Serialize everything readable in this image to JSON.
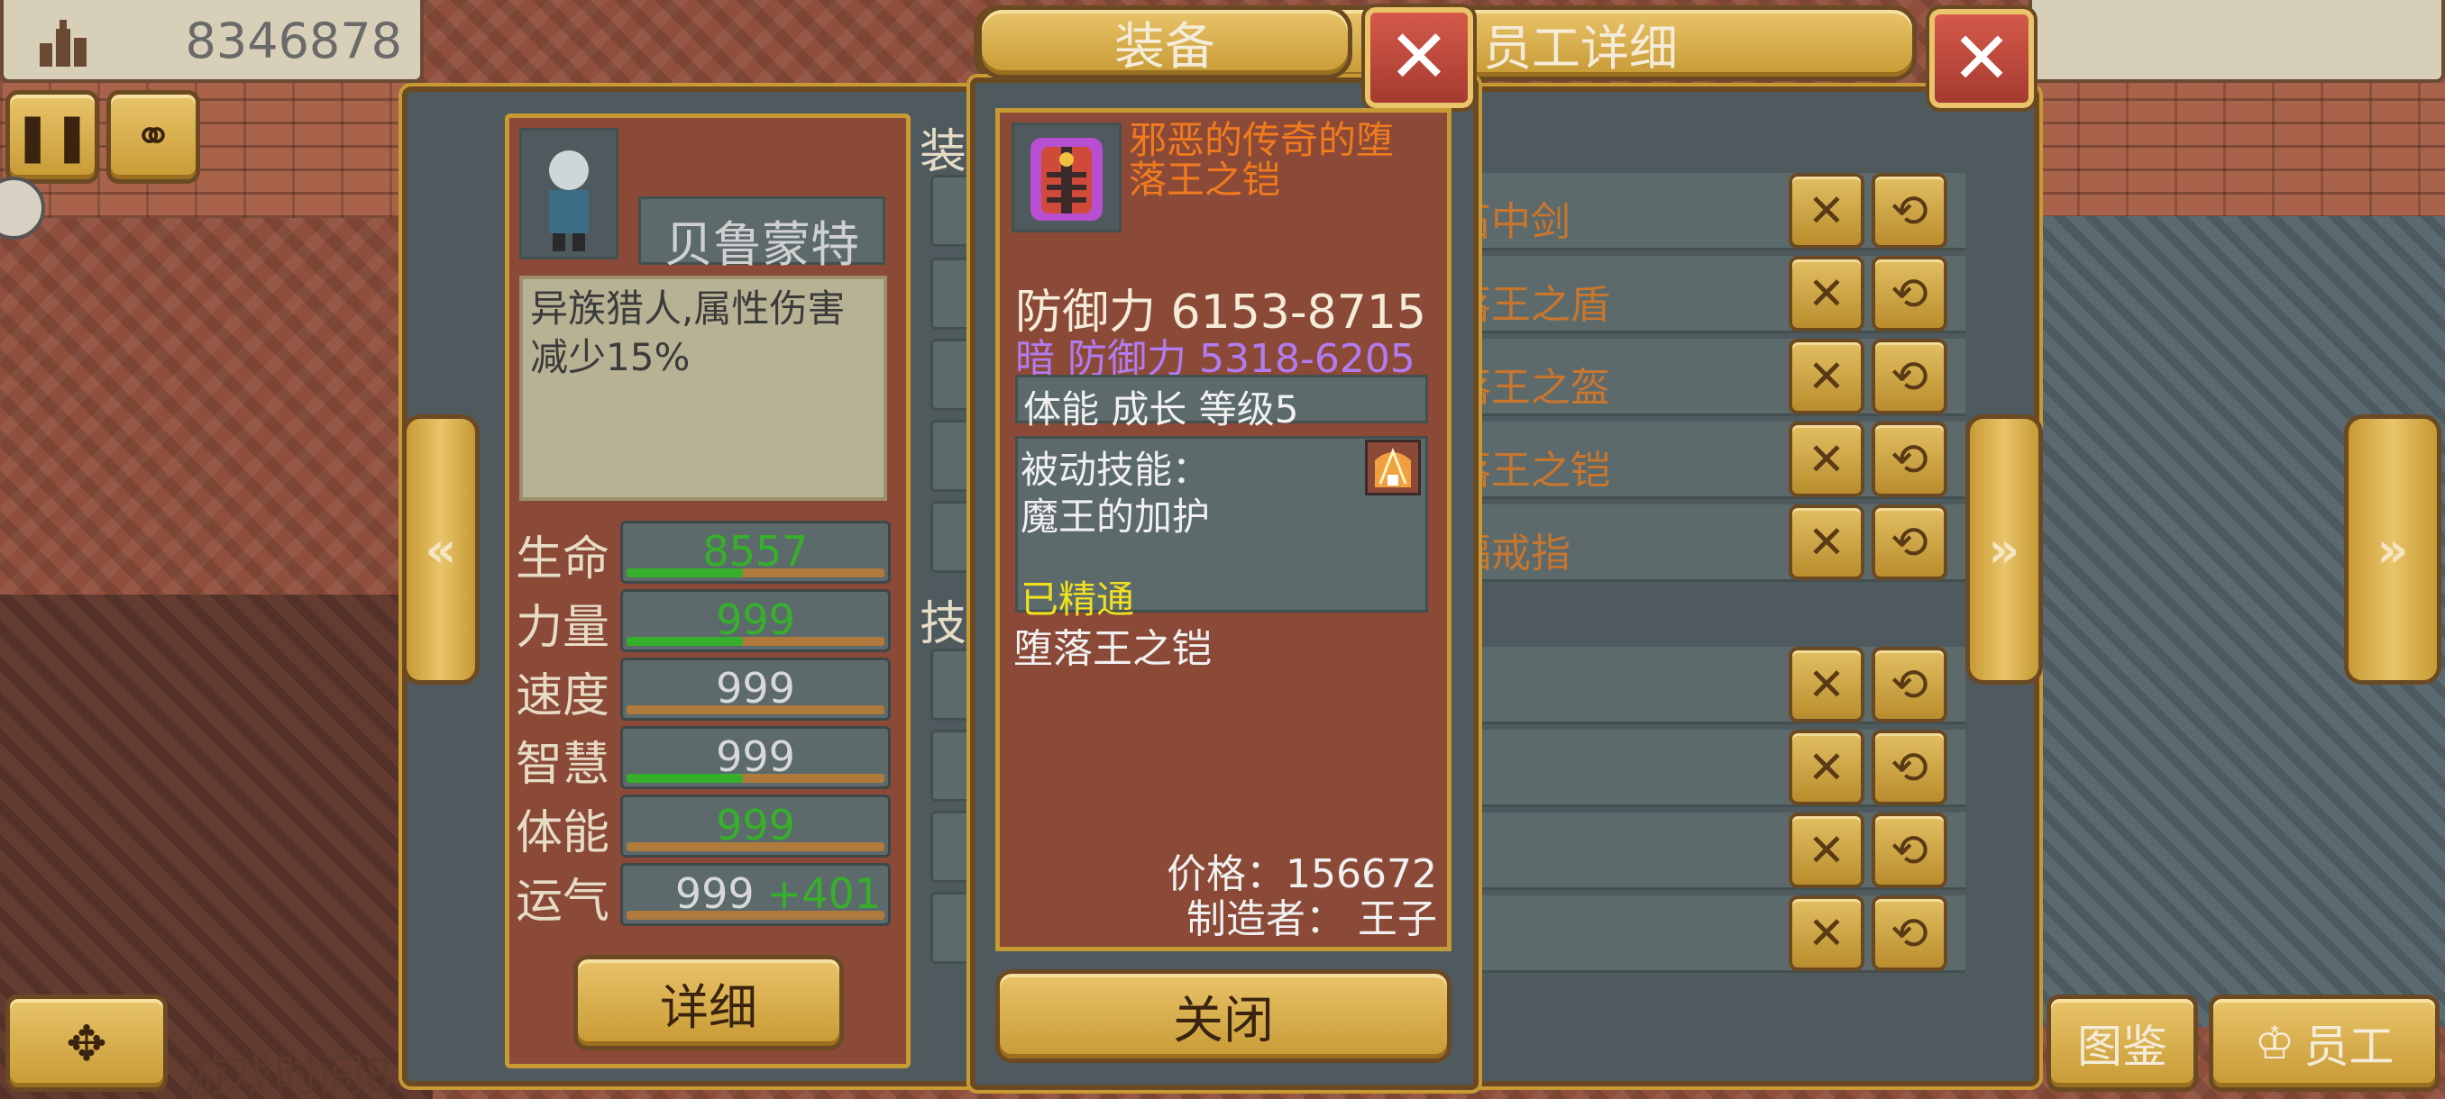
{
  "hud": {
    "money": "8346878",
    "game_time": "游戏时间8"
  },
  "dialog_equip": {
    "title": "装备",
    "close_label": "关闭"
  },
  "dialog_staff": {
    "title": "员工详细"
  },
  "character": {
    "name": "贝鲁蒙特",
    "description": "异族猎人,属性伤害减少15%",
    "detail_button": "详细"
  },
  "stats": [
    {
      "label": "生命",
      "value": "8557",
      "bonus": "",
      "value_color": "#36b02a",
      "fill": 0.45
    },
    {
      "label": "力量",
      "value": "999",
      "bonus": "",
      "value_color": "#36b02a",
      "fill": 0.45
    },
    {
      "label": "速度",
      "value": "999",
      "bonus": "",
      "value_color": "#d8d8d8",
      "fill": 0
    },
    {
      "label": "智慧",
      "value": "999",
      "bonus": "",
      "value_color": "#d8d8d8",
      "fill": 0.45
    },
    {
      "label": "体能",
      "value": "999",
      "bonus": "",
      "value_color": "#36b02a",
      "fill": 0
    },
    {
      "label": "运气",
      "value": "999",
      "bonus": "+401",
      "value_color": "#d8d8d8",
      "fill": 0
    }
  ],
  "section_labels": {
    "equip": "装",
    "skill": "技"
  },
  "equipment_rows": [
    "石中剑",
    "落王之盾",
    "落王之盔",
    "落王之铠",
    "福戒指"
  ],
  "skill_rows": [
    "",
    "",
    "",
    ""
  ],
  "item": {
    "name": "邪恶的传奇的堕落王之铠",
    "defense_label": "防御力",
    "defense_value": "6153-8715",
    "dark_defense": "暗 防御力 5318-6205",
    "growth": "体能 成长 等级5",
    "passive_title": "被动技能：",
    "passive_name": "魔王的加护",
    "mastered": "已精通",
    "base_name": "堕落王之铠",
    "price": "价格：156672",
    "maker": "制造者： 王子"
  },
  "bottom_buttons": {
    "encyclopedia": "图鉴",
    "staff": "员工"
  },
  "colors": {
    "gold": "#e9c46a",
    "panel": "#4f5a5e",
    "item_name": "#f07a1e",
    "dark_def": "#b07cf0",
    "mastered": "#f0e020"
  }
}
